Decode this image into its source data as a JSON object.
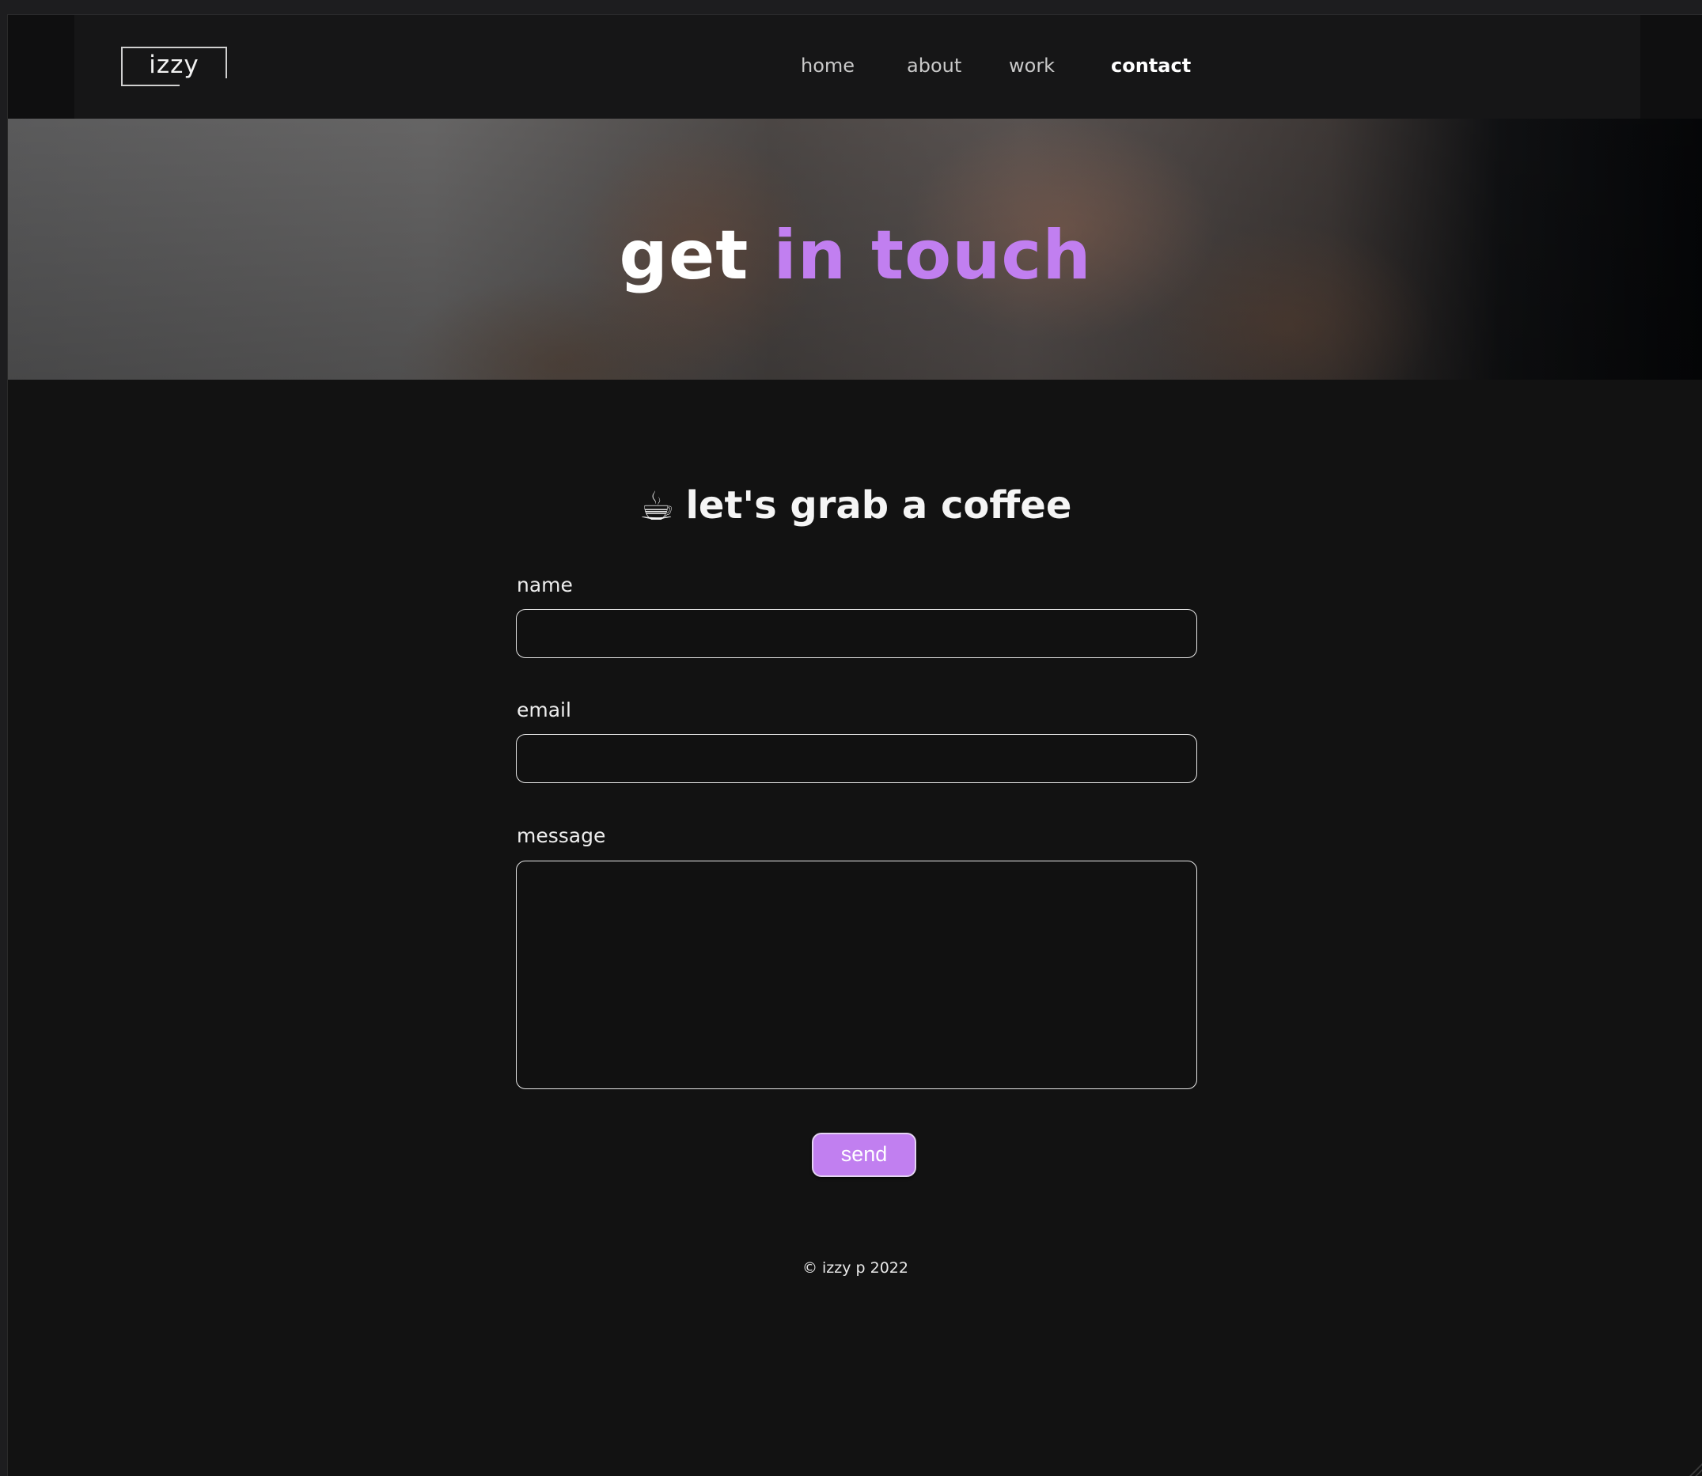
{
  "header": {
    "logo_text": "izzy",
    "nav": [
      {
        "label": "home",
        "active": false
      },
      {
        "label": "about",
        "active": false
      },
      {
        "label": "work",
        "active": false
      },
      {
        "label": "contact",
        "active": true
      }
    ]
  },
  "hero": {
    "title_plain": "get",
    "title_accent": "in touch"
  },
  "content": {
    "icon": "coffee-icon",
    "title": "let's grab a coffee"
  },
  "form": {
    "name_label": "name",
    "name_value": "",
    "email_label": "email",
    "email_value": "",
    "message_label": "message",
    "message_value": "",
    "send_label": "send"
  },
  "footer": {
    "text": "© izzy p 2022"
  },
  "colors": {
    "accent": "#c17ff0",
    "background": "#121212",
    "header": "#161617"
  }
}
